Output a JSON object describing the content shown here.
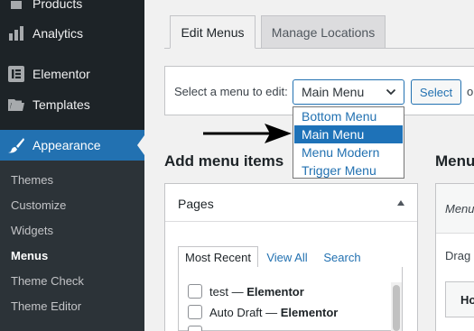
{
  "sidebar": {
    "items": [
      {
        "label": "Products",
        "icon": "products-icon"
      },
      {
        "label": "Analytics",
        "icon": "analytics-icon"
      },
      {
        "label": "Elementor",
        "icon": "elementor-icon"
      },
      {
        "label": "Templates",
        "icon": "folder-icon"
      },
      {
        "label": "Appearance",
        "icon": "paintbrush-icon",
        "active": true
      }
    ],
    "submenu": [
      "Themes",
      "Customize",
      "Widgets",
      "Menus",
      "Theme Check",
      "Theme Editor"
    ],
    "current_submenu": "Menus",
    "active_color": "#2271b1"
  },
  "tabs": {
    "edit": "Edit Menus",
    "manage": "Manage Locations"
  },
  "select_menu": {
    "label": "Select a menu to edit:",
    "selected": "Main Menu",
    "button": "Select",
    "trailing": "o",
    "options": [
      "Bottom Menu",
      "Main Menu",
      "Menu Modern",
      "Trigger Menu"
    ],
    "highlighted": "Main Menu"
  },
  "add_items": {
    "heading": "Add menu items",
    "panel_title": "Pages",
    "panel_tabs": [
      "Most Recent",
      "View All",
      "Search"
    ],
    "items": [
      {
        "title": "test",
        "sep": " — ",
        "builder": "Elementor"
      },
      {
        "title": "Auto Draft",
        "sep": " — ",
        "builder": "Elementor"
      },
      {
        "title": "",
        "sep": "",
        "builder": ""
      }
    ]
  },
  "menu_structure": {
    "heading": "Menu",
    "menu_label": "Menu",
    "drag_text": "Drag",
    "item_label": "Ho"
  }
}
